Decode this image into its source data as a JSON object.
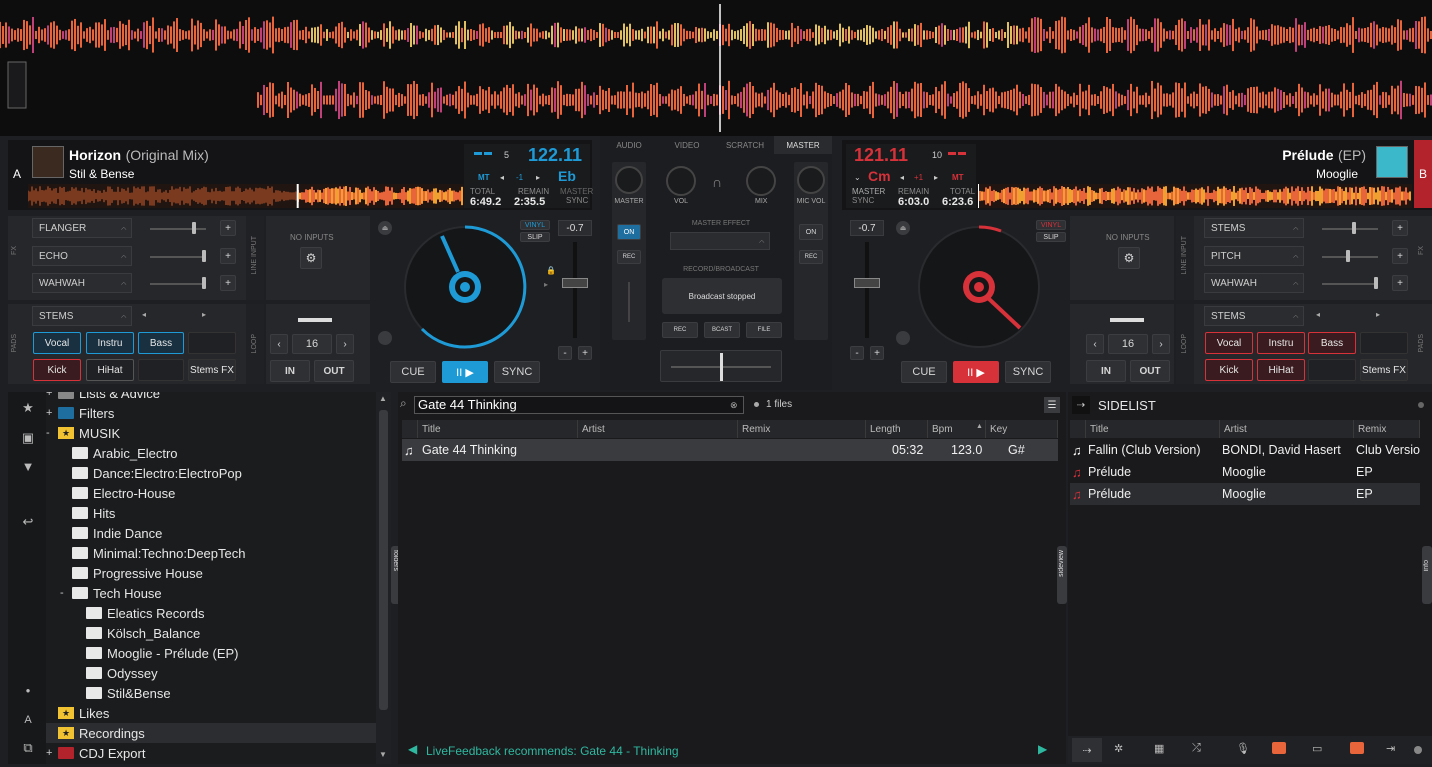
{
  "deck_a": {
    "letter": "A",
    "title": "Horizon",
    "subtitle": "(Original Mix)",
    "artist": "Stil & Bense",
    "bpm": "122.11",
    "key": "Eb",
    "beat_count": "5",
    "mt_label": "MT",
    "pitch_shift": "-1",
    "total_label": "TOTAL",
    "total": "6:49.2",
    "remain_label": "REMAIN",
    "remain": "2:35.5",
    "master_label": "MASTER",
    "sync_label": "SYNC",
    "fx": [
      "FLANGER",
      "ECHO",
      "WAHWAH"
    ],
    "fx_label": "FX",
    "line_input": "LINE INPUT",
    "no_inputs": "NO INPUTS",
    "vinyl": "VINYL",
    "slip": "SLIP",
    "pitch_value": "-0.7",
    "pads_label": "PADS",
    "pads_mode": "STEMS",
    "pads": [
      "Vocal",
      "Instru",
      "Bass",
      "Kick",
      "HiHat",
      "Stems FX"
    ],
    "loop_label": "LOOP",
    "loop_size": "16",
    "in": "IN",
    "out": "OUT",
    "cue": "CUE",
    "play": "II ▶",
    "sync": "SYNC",
    "minus": "-",
    "plus": "+"
  },
  "deck_b": {
    "letter": "B",
    "title": "Prélude",
    "subtitle": "(EP)",
    "artist": "Mooglie",
    "bpm": "121.11",
    "key": "Cm",
    "beat_count": "10",
    "mt_label": "MT",
    "pitch_shift": "+1",
    "total_label": "TOTAL",
    "total": "6:23.6",
    "remain_label": "REMAIN",
    "remain": "6:03.0",
    "master_label": "MASTER",
    "sync_label": "SYNC",
    "fx": [
      "STEMS",
      "PITCH",
      "WAHWAH"
    ],
    "fx_label": "FX",
    "line_input": "LINE INPUT",
    "no_inputs": "NO INPUTS",
    "vinyl": "VINYL",
    "slip": "SLIP",
    "pitch_value": "-0.7",
    "pads_label": "PADS",
    "pads_mode": "STEMS",
    "pads": [
      "Vocal",
      "Instru",
      "Bass",
      "Kick",
      "HiHat",
      "Stems FX"
    ],
    "loop_label": "LOOP",
    "loop_size": "16",
    "in": "IN",
    "out": "OUT",
    "cue": "CUE",
    "play": "II ▶",
    "sync": "SYNC",
    "minus": "-",
    "plus": "+"
  },
  "mixer": {
    "tabs": [
      "AUDIO",
      "VIDEO",
      "SCRATCH",
      "MASTER"
    ],
    "active_tab": "MASTER",
    "master": "MASTER",
    "vol": "VOL",
    "mix": "MIX",
    "mic_vol": "MIC VOL",
    "on": "ON",
    "rec": "REC",
    "master_effect": "MASTER EFFECT",
    "record_broadcast": "RECORD/BROADCAST",
    "broadcast_status": "Broadcast stopped",
    "rec_btn": "REC",
    "bcast_btn": "BCAST",
    "file_btn": "FILE"
  },
  "folders": {
    "items": [
      {
        "label": "Lists & Advice",
        "level": 0,
        "type": "list",
        "expander": "+"
      },
      {
        "label": "Filters",
        "level": 0,
        "type": "filter",
        "expander": "+"
      },
      {
        "label": "MUSIK",
        "level": 0,
        "type": "star",
        "expander": "-"
      },
      {
        "label": "Arabic_Electro",
        "level": 1,
        "type": "folder",
        "expander": ""
      },
      {
        "label": "Dance:Electro:ElectroPop",
        "level": 1,
        "type": "folder",
        "expander": ""
      },
      {
        "label": "Electro-House",
        "level": 1,
        "type": "folder",
        "expander": ""
      },
      {
        "label": "Hits",
        "level": 1,
        "type": "folder",
        "expander": ""
      },
      {
        "label": "Indie Dance",
        "level": 1,
        "type": "folder",
        "expander": ""
      },
      {
        "label": "Minimal:Techno:DeepTech",
        "level": 1,
        "type": "folder",
        "expander": ""
      },
      {
        "label": "Progressive House",
        "level": 1,
        "type": "folder",
        "expander": ""
      },
      {
        "label": "Tech House",
        "level": 1,
        "type": "folder",
        "expander": "-"
      },
      {
        "label": "Eleatics Records",
        "level": 2,
        "type": "folder",
        "expander": ""
      },
      {
        "label": "Kölsch_Balance",
        "level": 2,
        "type": "folder",
        "expander": ""
      },
      {
        "label": "Mooglie - Prélude (EP)",
        "level": 2,
        "type": "folder",
        "expander": ""
      },
      {
        "label": "Odyssey",
        "level": 2,
        "type": "folder",
        "expander": ""
      },
      {
        "label": "Stil&Bense",
        "level": 2,
        "type": "folder",
        "expander": ""
      },
      {
        "label": "Likes",
        "level": 0,
        "type": "star",
        "expander": ""
      },
      {
        "label": "Recordings",
        "level": 0,
        "type": "star",
        "expander": ""
      },
      {
        "label": "CDJ Export",
        "level": 0,
        "type": "cdj",
        "expander": "+"
      }
    ],
    "tab_label": "folders"
  },
  "search": {
    "value": "Gate 44 Thinking",
    "file_count": "1 files"
  },
  "playlist": {
    "columns": [
      "Title",
      "Artist",
      "Remix",
      "Length",
      "Bpm",
      "Key"
    ],
    "rows": [
      {
        "title": "Gate 44  Thinking",
        "artist": "",
        "remix": "",
        "length": "05:32",
        "bpm": "123.0",
        "key": "G#"
      }
    ],
    "livefeedback": "LiveFeedback recommends: Gate 44 - Thinking",
    "sideview_label": "sideview"
  },
  "sidelist": {
    "title": "SIDELIST",
    "columns": [
      "Title",
      "Artist",
      "Remix"
    ],
    "rows": [
      {
        "title": "Fallin (Club Version)",
        "artist": "BONDI, David Hasert",
        "remix": "Club Version"
      },
      {
        "title": "Prélude",
        "artist": "Mooglie",
        "remix": "EP"
      },
      {
        "title": "Prélude",
        "artist": "Mooglie",
        "remix": "EP"
      }
    ],
    "info_label": "info"
  },
  "colors": {
    "deck_a_accent": "#1e9bd7",
    "deck_b_accent": "#d7313a",
    "waveform": "#e8643a",
    "livefeedback": "#2fb8a0"
  }
}
